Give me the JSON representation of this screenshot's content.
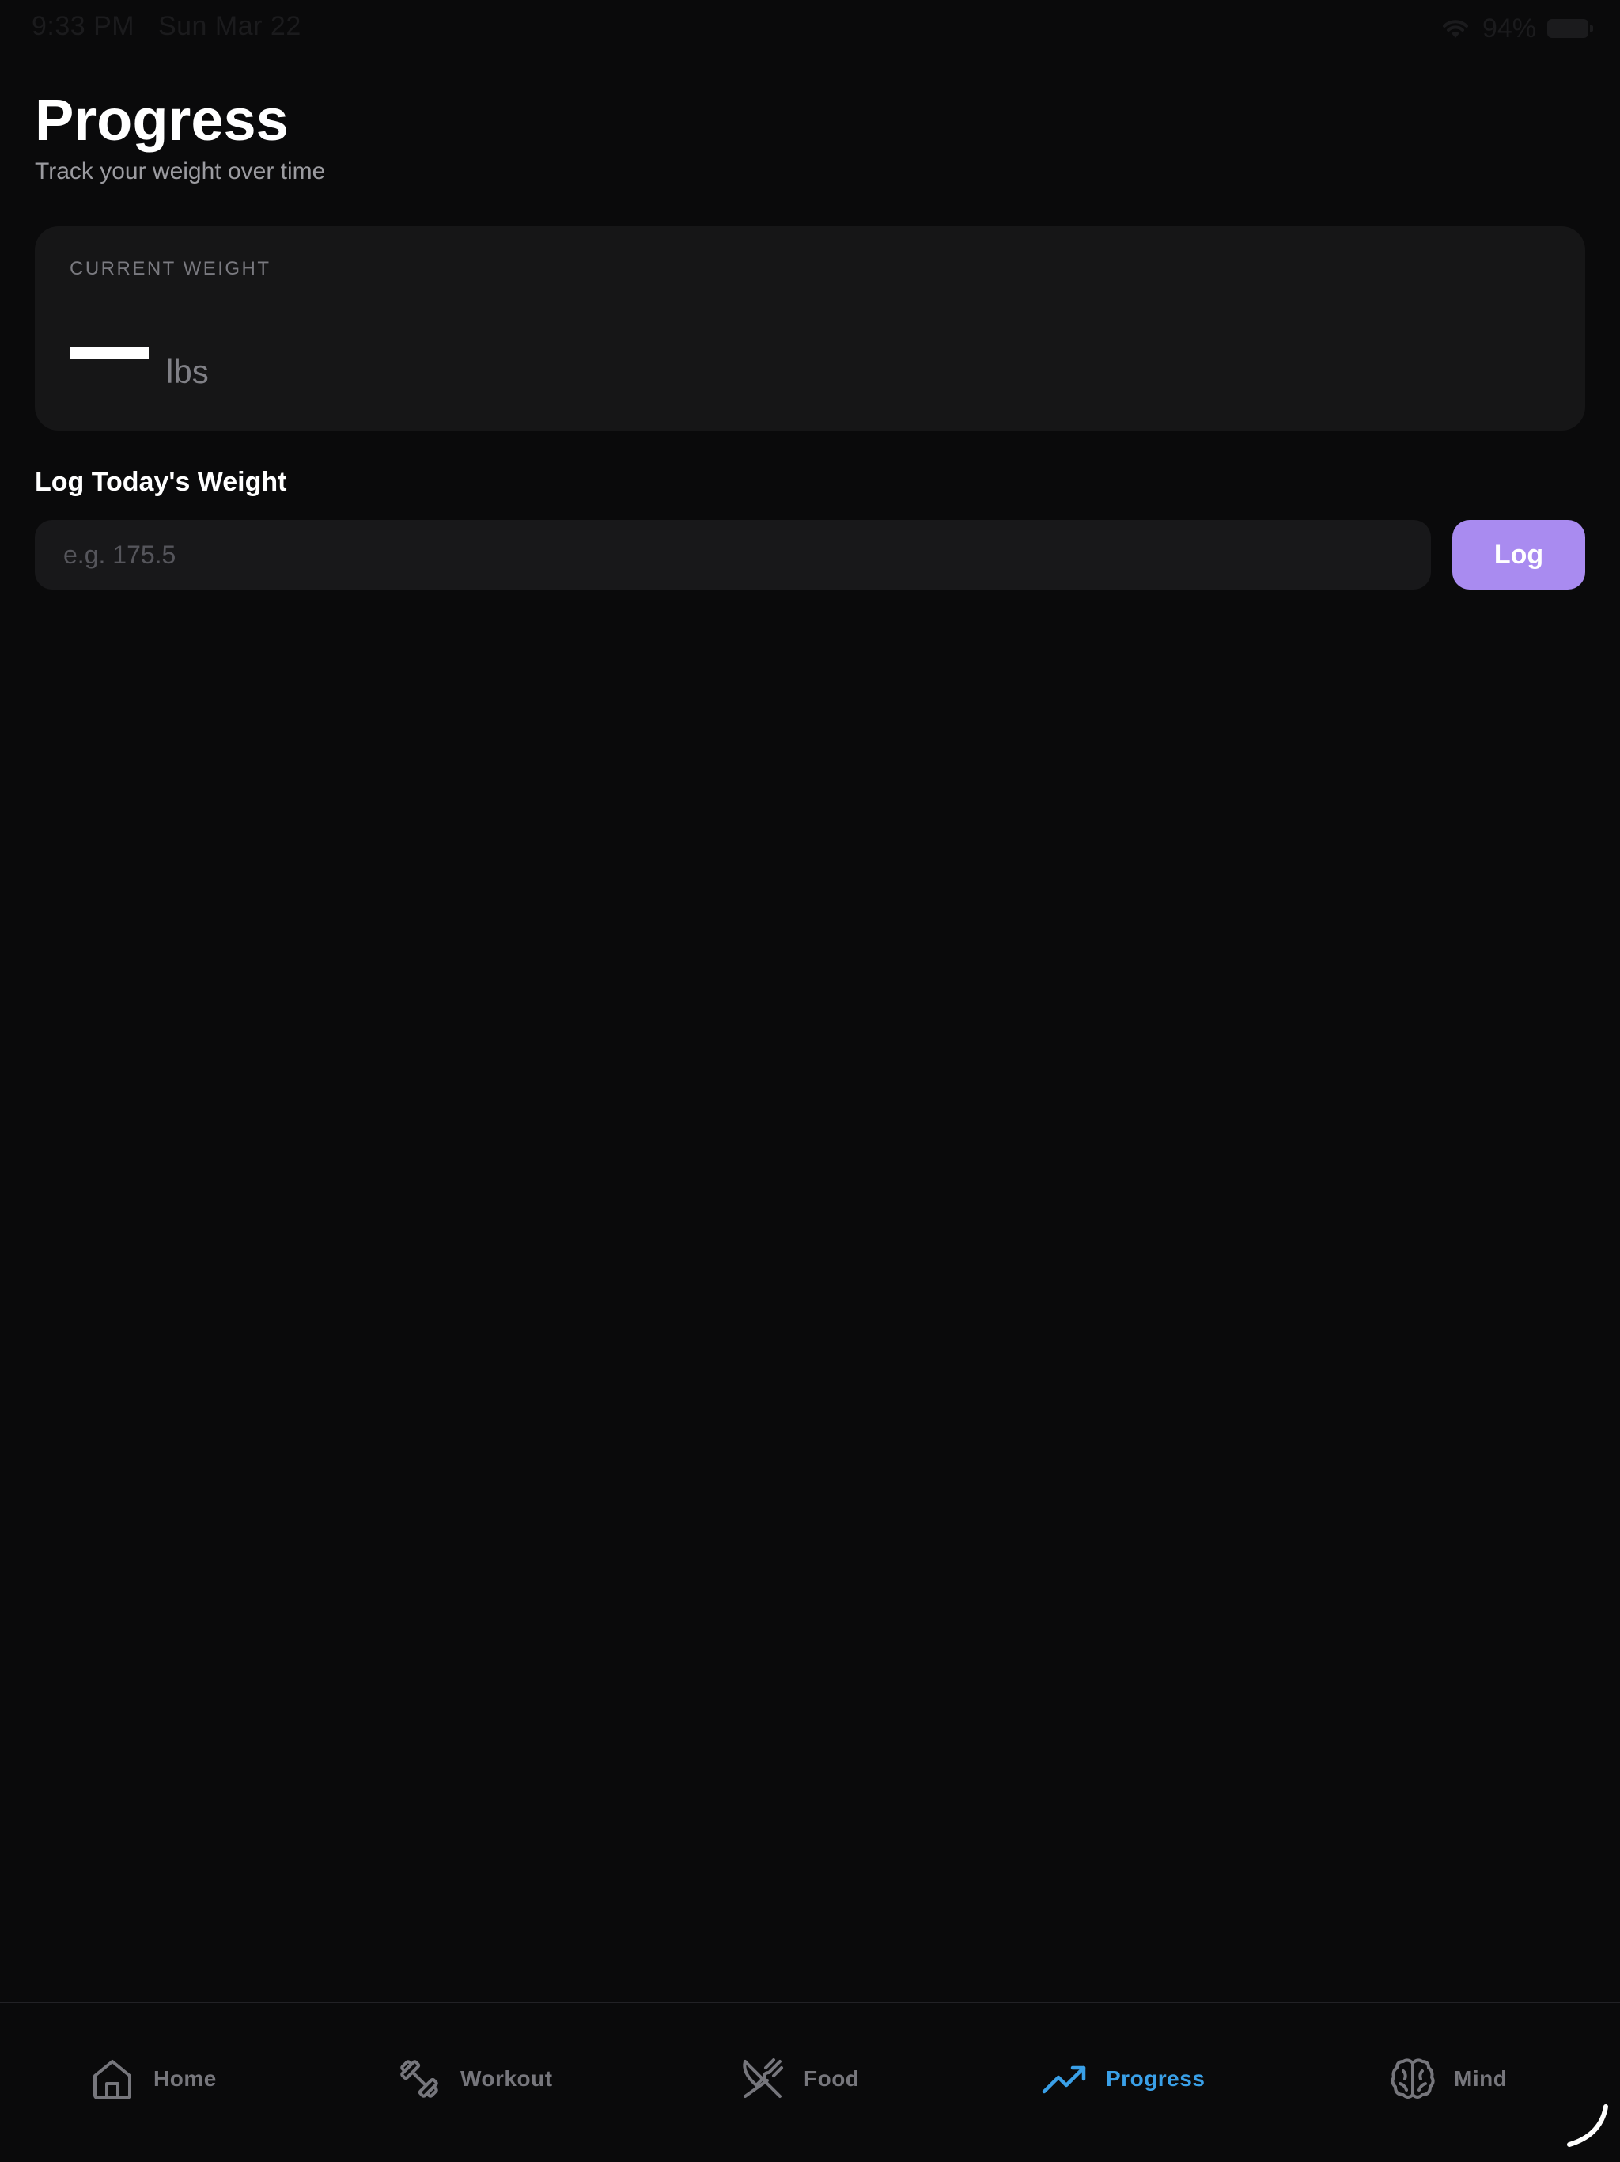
{
  "status_bar": {
    "time": "9:33 PM",
    "date": "Sun Mar 22",
    "battery": "94%"
  },
  "header": {
    "title": "Progress",
    "subtitle": "Track your weight over time"
  },
  "current_weight": {
    "label": "CURRENT WEIGHT",
    "value": "—",
    "unit": "lbs"
  },
  "log_weight": {
    "heading": "Log Today's Weight",
    "input_value": "",
    "placeholder": "e.g. 175.5",
    "button_label": "Log"
  },
  "tabs": [
    {
      "label": "Home",
      "icon": "home-icon",
      "active": false
    },
    {
      "label": "Workout",
      "icon": "dumbbell-icon",
      "active": false
    },
    {
      "label": "Food",
      "icon": "utensils-icon",
      "active": false
    },
    {
      "label": "Progress",
      "icon": "trending-up-icon",
      "active": true
    },
    {
      "label": "Mind",
      "icon": "brain-icon",
      "active": false
    }
  ],
  "colors": {
    "background": "#0a0a0b",
    "card": "#161617",
    "accent_button": "#a98bf0",
    "active_tab": "#3aa0e8",
    "inactive_tab": "#76767c"
  }
}
